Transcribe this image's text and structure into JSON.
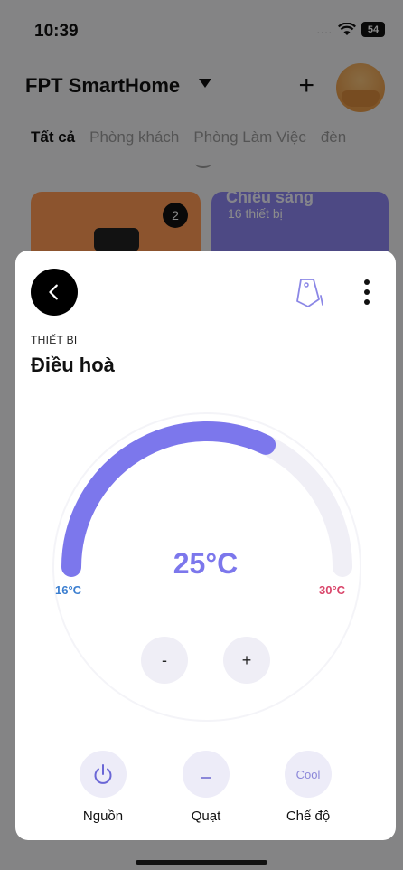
{
  "status_bar": {
    "time": "10:39",
    "signal": "....",
    "battery": "54"
  },
  "home": {
    "title": "FPT SmartHome",
    "add_label": "+",
    "tabs": [
      "Tất cả",
      "Phòng khách",
      "Phòng Làm Việc",
      "đèn"
    ],
    "cards": [
      {
        "badge": "2"
      },
      {
        "title": "Chiếu sáng",
        "subtitle": "16 thiết bị"
      }
    ]
  },
  "sheet": {
    "section_label": "THIẾT BỊ",
    "device_name": "Điều hoà",
    "thermostat": {
      "current": "25°C",
      "min_label": "16°C",
      "max_label": "30°C",
      "min": 16,
      "max": 30,
      "value": 25,
      "minus_label": "-",
      "plus_label": "+"
    },
    "controls": [
      {
        "label": "Nguồn",
        "icon": "power-icon"
      },
      {
        "label": "Quạt",
        "icon": "fan-speed-icon"
      },
      {
        "label": "Chế độ",
        "icon_text": "Cool"
      }
    ]
  },
  "colors": {
    "accent": "#7c77ec",
    "track": "#f0eff6",
    "min_color": "#3c7fd0",
    "max_color": "#d9456a"
  }
}
